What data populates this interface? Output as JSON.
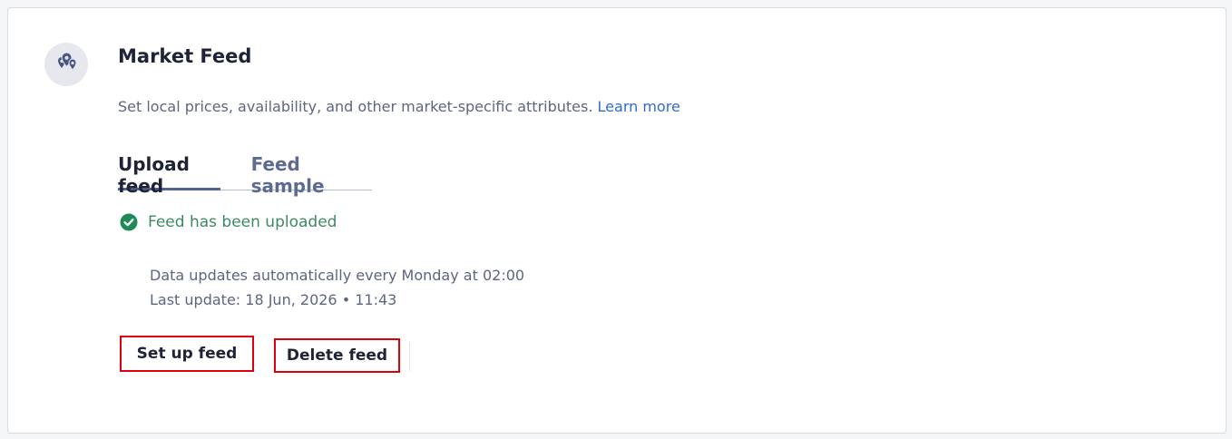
{
  "card": {
    "title": "Market Feed",
    "icon": "location-pins-icon",
    "description": "Set local prices, availability, and other market-specific attributes.",
    "learn_more": "Learn more"
  },
  "tabs": [
    {
      "label": "Upload feed",
      "active": true
    },
    {
      "label": "Feed sample",
      "active": false
    }
  ],
  "status": {
    "text": "Feed has been uploaded",
    "icon": "check-circle-icon",
    "color": "#3d8a62"
  },
  "info": {
    "schedule": "Data updates automatically every Monday at 02:00",
    "last_update": "Last update: 18 Jun, 2026 • 11:43"
  },
  "buttons": {
    "setup": "Set up feed",
    "delete": "Delete feed"
  },
  "colors": {
    "accent": "#2f6bd7",
    "tab_indicator": "#4f6395",
    "highlight": "#e0000b"
  }
}
